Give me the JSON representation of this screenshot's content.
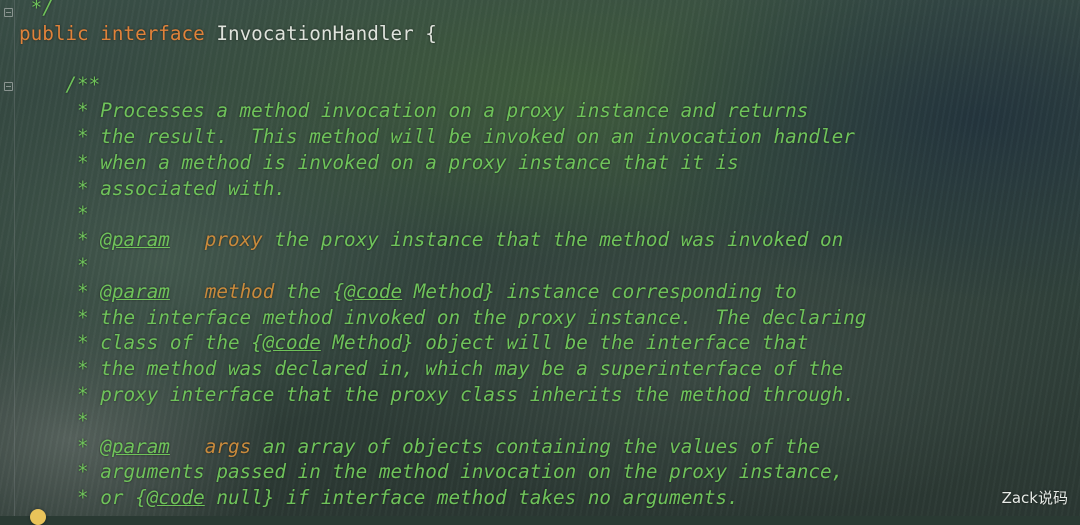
{
  "editor": {
    "language": "java",
    "lines": [
      [
        {
          "t": "cm",
          "v": " */"
        }
      ],
      [
        {
          "t": "kw",
          "v": "public"
        },
        {
          "t": "pl",
          "v": " "
        },
        {
          "t": "kw",
          "v": "interface"
        },
        {
          "t": "pl",
          "v": " "
        },
        {
          "t": "ident",
          "v": "InvocationHandler"
        },
        {
          "t": "pl",
          "v": " {"
        }
      ],
      [],
      [
        {
          "t": "cm",
          "v": "    /**"
        }
      ],
      [
        {
          "t": "cm",
          "v": "     * Processes a method invocation on a proxy instance and returns"
        }
      ],
      [
        {
          "t": "cm",
          "v": "     * the result.  This method will be invoked on an invocation handler"
        }
      ],
      [
        {
          "t": "cm",
          "v": "     * when a method is invoked on a proxy instance that it is"
        }
      ],
      [
        {
          "t": "cm",
          "v": "     * associated with."
        }
      ],
      [
        {
          "t": "cm",
          "v": "     *"
        }
      ],
      [
        {
          "t": "cm",
          "v": "     * "
        },
        {
          "t": "tag",
          "v": "@param"
        },
        {
          "t": "cm",
          "v": "   "
        },
        {
          "t": "pname",
          "v": "proxy"
        },
        {
          "t": "cm",
          "v": " the proxy instance that the method was invoked on"
        }
      ],
      [
        {
          "t": "cm",
          "v": "     *"
        }
      ],
      [
        {
          "t": "cm",
          "v": "     * "
        },
        {
          "t": "tag",
          "v": "@param"
        },
        {
          "t": "cm",
          "v": "   "
        },
        {
          "t": "pname",
          "v": "method"
        },
        {
          "t": "cm",
          "v": " the {"
        },
        {
          "t": "tag",
          "v": "@code"
        },
        {
          "t": "cm",
          "v": " Method} instance corresponding to"
        }
      ],
      [
        {
          "t": "cm",
          "v": "     * the interface method invoked on the proxy instance.  The declaring"
        }
      ],
      [
        {
          "t": "cm",
          "v": "     * class of the {"
        },
        {
          "t": "tag",
          "v": "@code"
        },
        {
          "t": "cm",
          "v": " Method} object will be the interface that"
        }
      ],
      [
        {
          "t": "cm",
          "v": "     * the method was declared in, which may be a superinterface of the"
        }
      ],
      [
        {
          "t": "cm",
          "v": "     * proxy interface that the proxy class inherits the method through."
        }
      ],
      [
        {
          "t": "cm",
          "v": "     *"
        }
      ],
      [
        {
          "t": "cm",
          "v": "     * "
        },
        {
          "t": "tag",
          "v": "@param"
        },
        {
          "t": "cm",
          "v": "   "
        },
        {
          "t": "pname",
          "v": "args"
        },
        {
          "t": "cm",
          "v": " an array of objects containing the values of the"
        }
      ],
      [
        {
          "t": "cm",
          "v": "     * arguments passed in the method invocation on the proxy instance,"
        }
      ],
      [
        {
          "t": "cm",
          "v": "     * or {"
        },
        {
          "t": "tag",
          "v": "@code"
        },
        {
          "t": "cm",
          "v": " null} if interface method takes no arguments."
        }
      ]
    ]
  },
  "gutter": {
    "fold_icons": [
      "fold-marker-icon",
      "fold-marker-icon"
    ],
    "intention_icon": "lightbulb-icon"
  },
  "watermark": {
    "text": "Zack说码"
  }
}
